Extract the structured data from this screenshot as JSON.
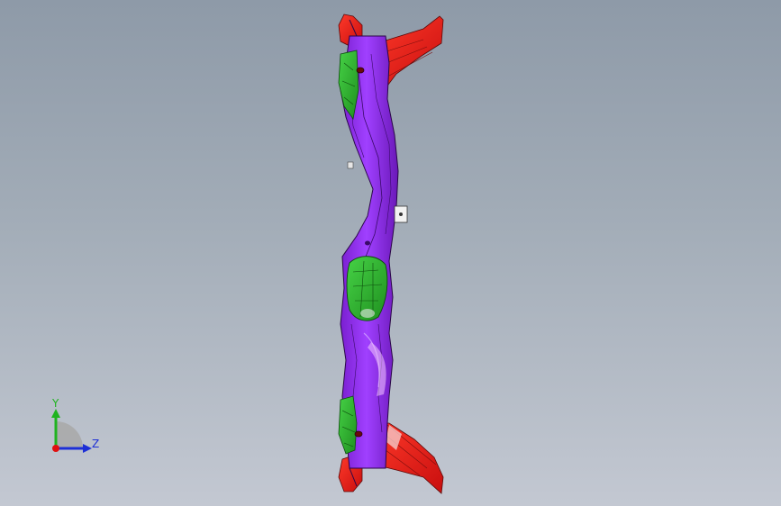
{
  "viewport": {
    "background_top": "#8e9aa8",
    "background_bottom": "#c3c8d2"
  },
  "model": {
    "part_colors": {
      "main_rail": "#9a2cf0",
      "brackets": "#ff2020",
      "inner_panels": "#2fbf2f"
    }
  },
  "triad": {
    "y_label": "Y",
    "z_label": "Z",
    "y_color": "#1fb31f",
    "z_color": "#1d2fd6",
    "x_color": "#e01010"
  }
}
